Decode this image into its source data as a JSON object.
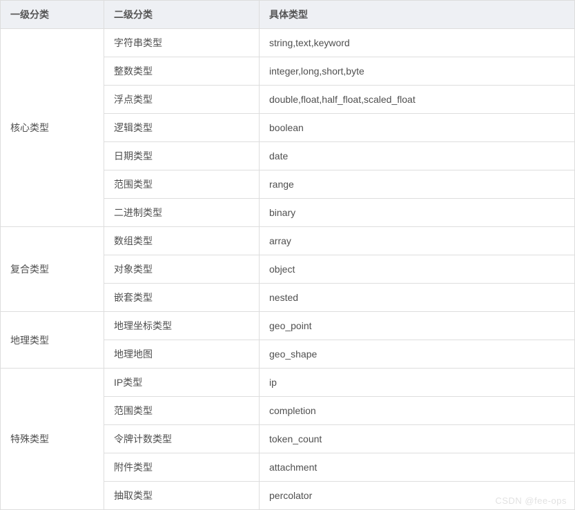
{
  "headers": {
    "col1": "一级分类",
    "col2": "二级分类",
    "col3": "具体类型"
  },
  "groups": [
    {
      "name": "核心类型",
      "rows": [
        {
          "sub": "字符串类型",
          "types": "string,text,keyword"
        },
        {
          "sub": "整数类型",
          "types": "integer,long,short,byte"
        },
        {
          "sub": "浮点类型",
          "types": "double,float,half_float,scaled_float"
        },
        {
          "sub": "逻辑类型",
          "types": "boolean"
        },
        {
          "sub": "日期类型",
          "types": "date"
        },
        {
          "sub": "范围类型",
          "types": "range"
        },
        {
          "sub": "二进制类型",
          "types": "binary"
        }
      ]
    },
    {
      "name": "复合类型",
      "rows": [
        {
          "sub": "数组类型",
          "types": "array"
        },
        {
          "sub": "对象类型",
          "types": "object"
        },
        {
          "sub": "嵌套类型",
          "types": "nested"
        }
      ]
    },
    {
      "name": "地理类型",
      "rows": [
        {
          "sub": "地理坐标类型",
          "types": "geo_point"
        },
        {
          "sub": "地理地图",
          "types": "geo_shape"
        }
      ]
    },
    {
      "name": "特殊类型",
      "rows": [
        {
          "sub": "IP类型",
          "types": "ip"
        },
        {
          "sub": "范围类型",
          "types": "completion"
        },
        {
          "sub": "令牌计数类型",
          "types": "token_count"
        },
        {
          "sub": "附件类型",
          "types": "attachment"
        },
        {
          "sub": "抽取类型",
          "types": "percolator"
        }
      ]
    }
  ],
  "watermark": "CSDN @fee-ops"
}
